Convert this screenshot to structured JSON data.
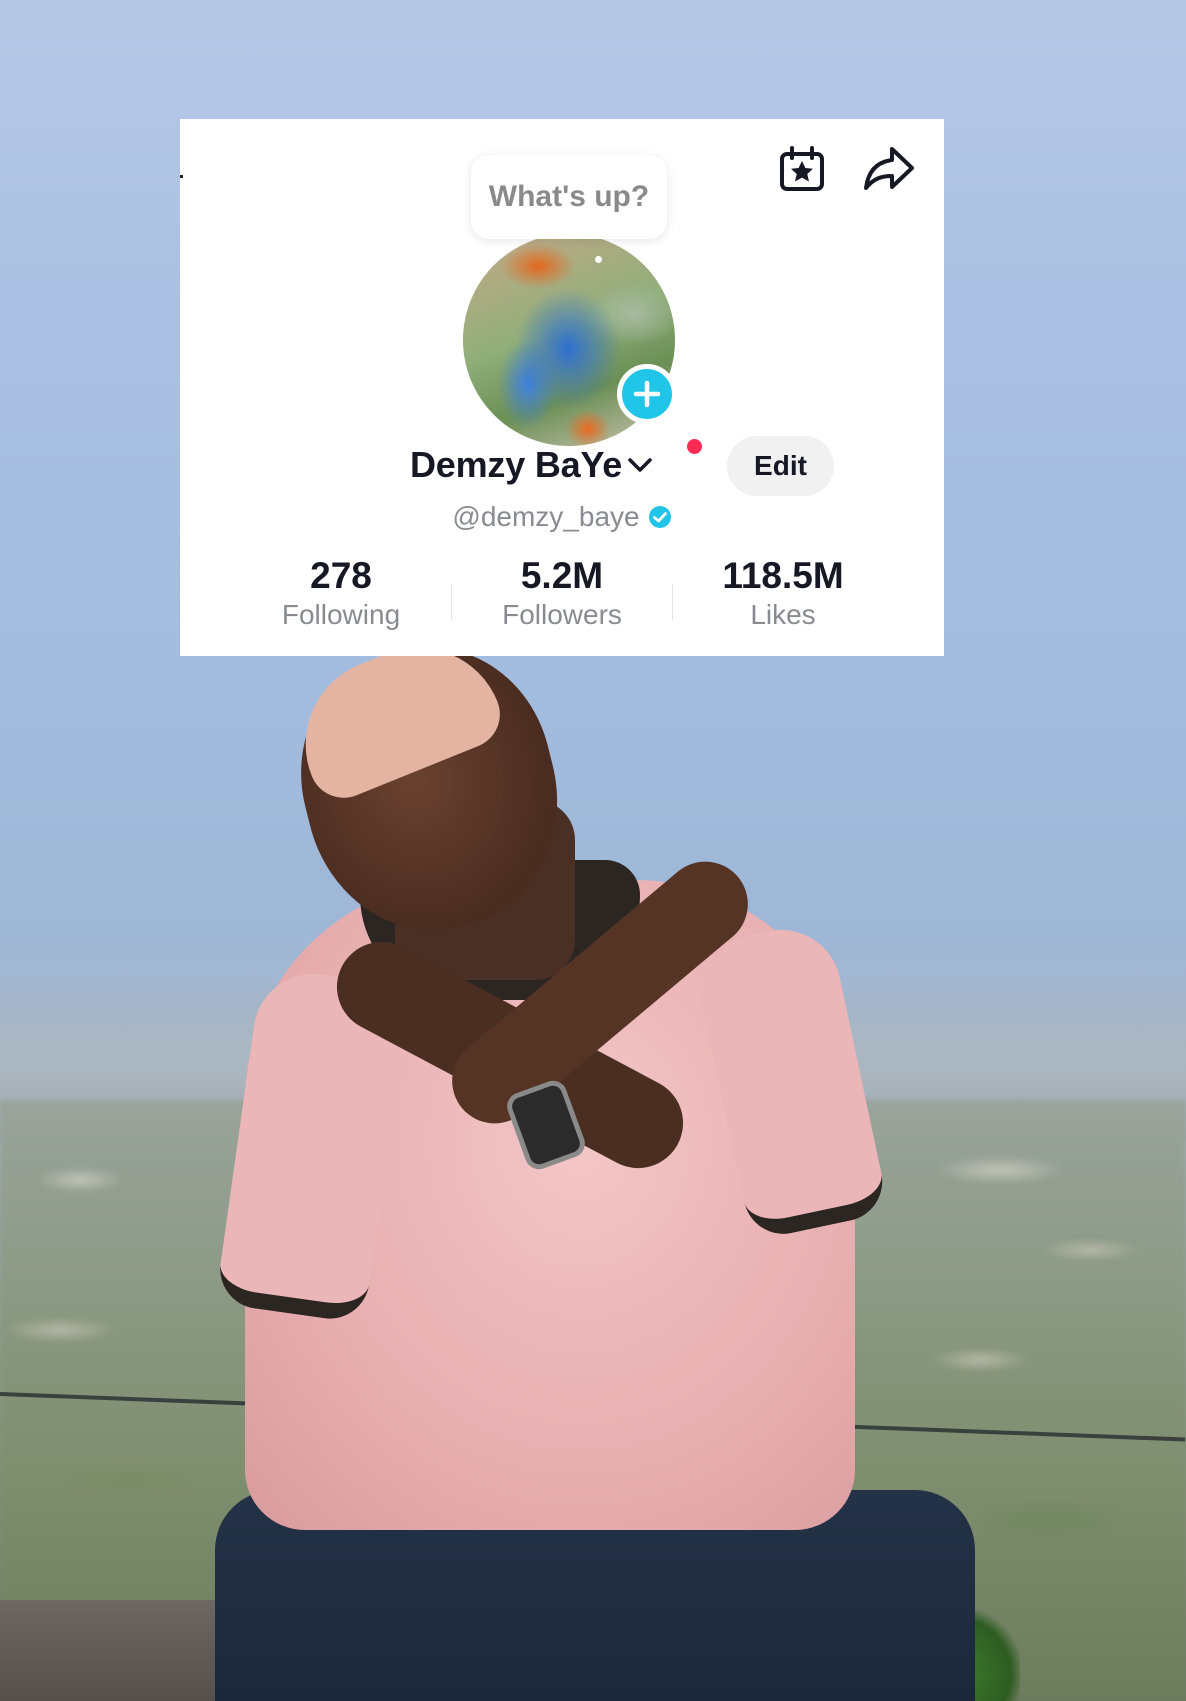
{
  "profile": {
    "status_prompt": "What's up?",
    "display_name": "Demzy BaYe",
    "username": "@demzy_baye",
    "edit_label": "Edit",
    "stats": [
      {
        "value": "278",
        "label": "Following"
      },
      {
        "value": "5.2M",
        "label": "Followers"
      },
      {
        "value": "118.5M",
        "label": "Likes"
      }
    ]
  },
  "icons": {
    "calendar": "calendar-star-icon",
    "share": "share-arrow-icon",
    "add": "plus-icon",
    "dropdown": "chevron-down-icon",
    "verified": "verified-badge-icon"
  },
  "colors": {
    "accent_cyan": "#20c5e8",
    "notification_red": "#fe2c55",
    "text_primary": "#161823",
    "text_secondary": "#8a8b91"
  }
}
